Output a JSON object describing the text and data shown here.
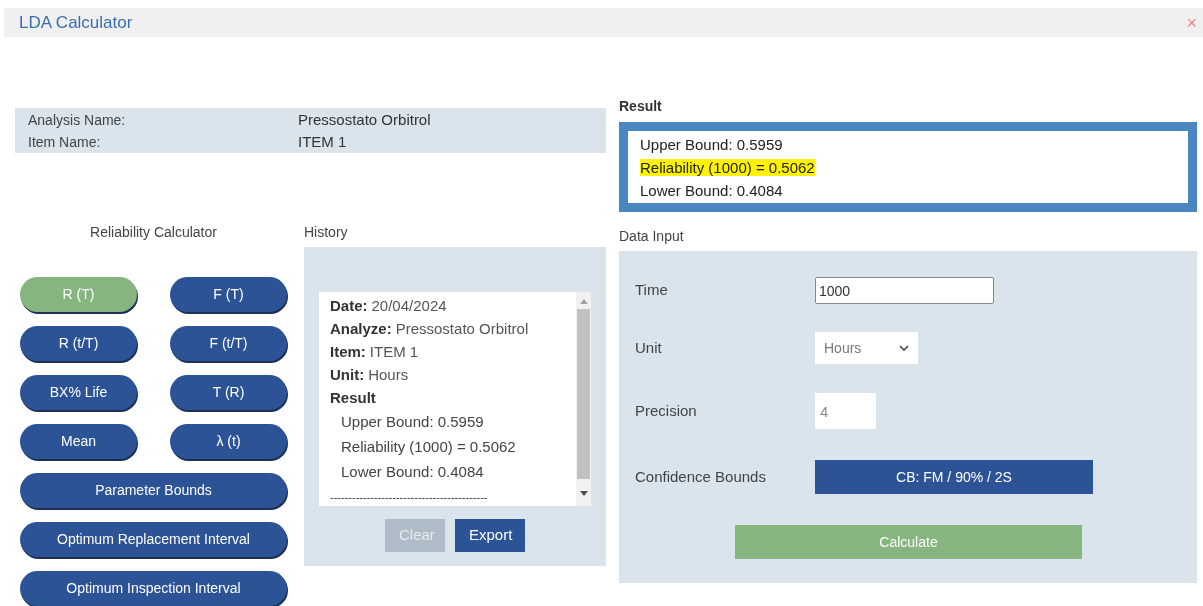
{
  "window": {
    "title": "LDA Calculator",
    "close": "×"
  },
  "info": [
    {
      "label": "Analysis Name:",
      "value": "Pressostato Orbitrol"
    },
    {
      "label": "Item Name:",
      "value": "ITEM 1"
    }
  ],
  "calculator": {
    "title": "Reliability Calculator",
    "buttons": [
      {
        "label": "R (T)",
        "selected": true,
        "kind": "half"
      },
      {
        "label": "F (T)",
        "selected": false,
        "kind": "half"
      },
      {
        "label": "R (t/T)",
        "selected": false,
        "kind": "half"
      },
      {
        "label": "F (t/T)",
        "selected": false,
        "kind": "half"
      },
      {
        "label": "BX% Life",
        "selected": false,
        "kind": "half"
      },
      {
        "label": "T (R)",
        "selected": false,
        "kind": "half"
      },
      {
        "label": "Mean",
        "selected": false,
        "kind": "half"
      },
      {
        "label": "λ (t)",
        "selected": false,
        "kind": "half"
      },
      {
        "label": "Parameter Bounds",
        "selected": false,
        "kind": "wide"
      },
      {
        "label": "Optimum Replacement Interval",
        "selected": false,
        "kind": "wide"
      },
      {
        "label": "Optimum Inspection Interval",
        "selected": false,
        "kind": "wide"
      }
    ]
  },
  "history": {
    "title": "History",
    "entries": [
      {
        "kind": "field",
        "label": "Date:",
        "value": "20/04/2024"
      },
      {
        "kind": "field",
        "label": "Analyze:",
        "value": "Pressostato Orbitrol"
      },
      {
        "kind": "field",
        "label": "Item:",
        "value": "ITEM 1"
      },
      {
        "kind": "field",
        "label": "Unit:",
        "value": "Hours"
      },
      {
        "kind": "heading",
        "value": "Result"
      },
      {
        "kind": "result",
        "value": "Upper Bound: 0.5959"
      },
      {
        "kind": "result",
        "value": "Reliability (1000) = 0.5062"
      },
      {
        "kind": "result",
        "value": "Lower Bound: 0.4084"
      },
      {
        "kind": "separator",
        "value": "-------------------------------------------"
      }
    ],
    "buttons": [
      {
        "label": "Clear",
        "disabled": true
      },
      {
        "label": "Export",
        "disabled": false
      }
    ]
  },
  "result": {
    "title": "Result",
    "lines": [
      {
        "text": "Upper Bound: 0.5959",
        "highlighted": false
      },
      {
        "text": "Reliability (1000) = 0.5062",
        "highlighted": true
      },
      {
        "text": "Lower Bound: 0.4084",
        "highlighted": false
      }
    ]
  },
  "data_input": {
    "title": "Data Input",
    "time": {
      "label": "Time",
      "value": "1000"
    },
    "unit": {
      "label": "Unit",
      "value": "Hours"
    },
    "precision": {
      "label": "Precision",
      "value": "4"
    },
    "confidence_bounds": {
      "label": "Confidence Bounds",
      "value": "CB: FM / 90% / 2S"
    },
    "calculate": "Calculate"
  }
}
